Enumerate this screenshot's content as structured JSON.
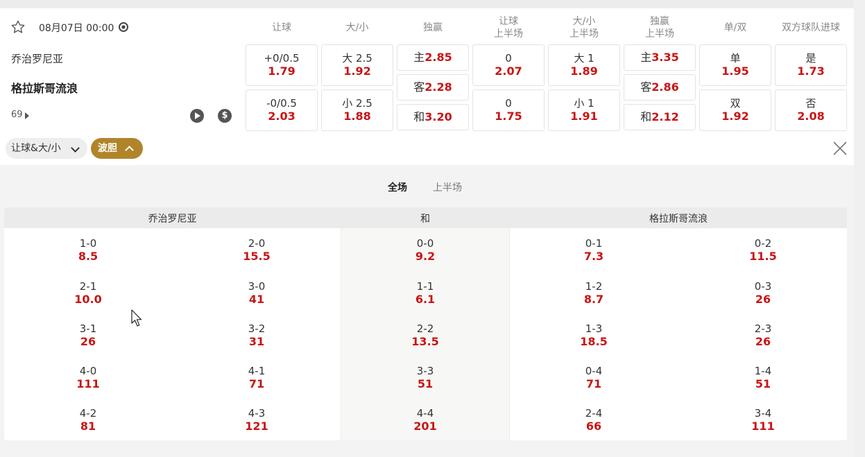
{
  "match": {
    "datetime": "08月07日 00:00",
    "home": "乔治罗尼亚",
    "away": "格拉斯哥流浪",
    "more_count": "69"
  },
  "columns": [
    "让球",
    "大/小",
    "独赢",
    "让球\n上半场",
    "大/小\n上半场",
    "独赢\n上半场",
    "单/双",
    "双方球队进球"
  ],
  "markets": {
    "handicap": [
      {
        "line": "+0/0.5",
        "odds": "1.79"
      },
      {
        "line": "-0/0.5",
        "odds": "2.03"
      }
    ],
    "over_under": [
      {
        "line": "大 2.5",
        "odds": "1.92"
      },
      {
        "line": "小 2.5",
        "odds": "1.88"
      }
    ],
    "moneyline": [
      {
        "label": "主",
        "odds": "2.85"
      },
      {
        "label": "客",
        "odds": "2.28"
      },
      {
        "label": "和",
        "odds": "3.20"
      }
    ],
    "handicap_1h": [
      {
        "line": "0",
        "odds": "2.07"
      },
      {
        "line": "0",
        "odds": "1.75"
      }
    ],
    "over_under_1h": [
      {
        "line": "大 1",
        "odds": "1.89"
      },
      {
        "line": "小 1",
        "odds": "1.91"
      }
    ],
    "moneyline_1h": [
      {
        "label": "主",
        "odds": "3.35"
      },
      {
        "label": "客",
        "odds": "2.86"
      },
      {
        "label": "和",
        "odds": "2.12"
      }
    ],
    "odd_even": [
      {
        "line": "单",
        "odds": "1.95"
      },
      {
        "line": "双",
        "odds": "1.92"
      }
    ],
    "btts": [
      {
        "line": "是",
        "odds": "1.73"
      },
      {
        "line": "否",
        "odds": "2.08"
      }
    ]
  },
  "filters": {
    "handicap_ou": "让球&大/小",
    "correct_score": "波胆"
  },
  "tabs": {
    "full": "全场",
    "half": "上半场"
  },
  "correct_score": {
    "headers": {
      "home": "乔治罗尼亚",
      "draw": "和",
      "away": "格拉斯哥流浪"
    },
    "home_a": [
      {
        "s": "1-0",
        "o": "8.5"
      },
      {
        "s": "2-1",
        "o": "10.0"
      },
      {
        "s": "3-1",
        "o": "26"
      },
      {
        "s": "4-0",
        "o": "111"
      },
      {
        "s": "4-2",
        "o": "81"
      }
    ],
    "home_b": [
      {
        "s": "2-0",
        "o": "15.5"
      },
      {
        "s": "3-0",
        "o": "41"
      },
      {
        "s": "3-2",
        "o": "31"
      },
      {
        "s": "4-1",
        "o": "71"
      },
      {
        "s": "4-3",
        "o": "121"
      }
    ],
    "draw": [
      {
        "s": "0-0",
        "o": "9.2"
      },
      {
        "s": "1-1",
        "o": "6.1"
      },
      {
        "s": "2-2",
        "o": "13.5"
      },
      {
        "s": "3-3",
        "o": "51"
      },
      {
        "s": "4-4",
        "o": "201"
      }
    ],
    "away_a": [
      {
        "s": "0-1",
        "o": "7.3"
      },
      {
        "s": "1-2",
        "o": "8.7"
      },
      {
        "s": "1-3",
        "o": "18.5"
      },
      {
        "s": "0-4",
        "o": "71"
      },
      {
        "s": "2-4",
        "o": "66"
      }
    ],
    "away_b": [
      {
        "s": "0-2",
        "o": "11.5"
      },
      {
        "s": "0-3",
        "o": "26"
      },
      {
        "s": "2-3",
        "o": "26"
      },
      {
        "s": "1-4",
        "o": "51"
      },
      {
        "s": "3-4",
        "o": "111"
      }
    ]
  },
  "colors": {
    "odds_red": "#c81414",
    "accent_gold": "#b0852a"
  },
  "icons": [
    "star-icon",
    "clock-icon",
    "play-icon",
    "dollar-icon",
    "chevron-down-icon",
    "chevron-up-icon",
    "close-icon"
  ]
}
